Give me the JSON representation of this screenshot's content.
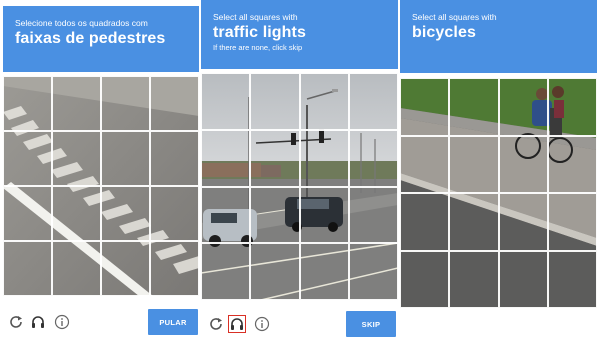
{
  "panels": [
    {
      "instruction": "Selecione todos os quadrados com",
      "keyword": "faixas de pedestres",
      "sub": "",
      "button": "PULAR",
      "tiles": 16
    },
    {
      "instruction": "Select all squares with",
      "keyword": "traffic lights",
      "sub": "If there are none, click skip",
      "button": "SKIP",
      "tiles": 16
    },
    {
      "instruction": "Select all squares with",
      "keyword": "bicycles",
      "sub": "",
      "tiles": 16
    }
  ],
  "icons": [
    "reload-icon",
    "audio-icon",
    "info-icon"
  ],
  "colors": {
    "header": "#4a90e2",
    "selected_outline": "#d93025"
  }
}
